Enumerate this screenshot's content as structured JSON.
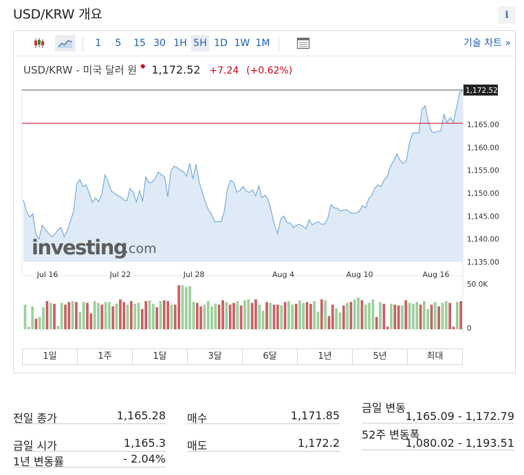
{
  "page": {
    "title": "USD/KRW 개요",
    "info_icon": "i"
  },
  "toolbar": {
    "candle_icon": "candlestick-icon",
    "area_icon": "area-chart-icon",
    "intervals": [
      "1",
      "5",
      "15",
      "30",
      "1H",
      "5H",
      "1D",
      "1W",
      "1M"
    ],
    "selected_interval": "5H",
    "table_icon": "table-icon",
    "tech_chart_label": "기술 차트 »"
  },
  "quote": {
    "name": "USD/KRW - 미국 달러 원",
    "price": "1,172.52",
    "change": "+7.24",
    "change_pct": "(+0.62%)",
    "up_color": "#d0021b"
  },
  "watermark": {
    "brand": "investing",
    "suffix": ".com"
  },
  "chart_data": {
    "type": "area",
    "x_tick_labels": [
      "Jul 16",
      "Jul 22",
      "Jul 28",
      "Aug 4",
      "Aug 10",
      "Aug 16"
    ],
    "y_tick_labels": [
      "1,135.00",
      "1,140.00",
      "1,145.00",
      "1,150.00",
      "1,155.00",
      "1,160.00",
      "1,165.00"
    ],
    "ylim": [
      1135,
      1170
    ],
    "last_price_label": "1,172.52",
    "last_price": 1172.52,
    "reference_line": 1165.28,
    "values": [
      1148.5,
      1146,
      1144.8,
      1145.5,
      1141,
      1140,
      1143,
      1142,
      1141.3,
      1140.5,
      1141,
      1142,
      1142.5,
      1140.5,
      1141.8,
      1144,
      1146,
      1152,
      1153,
      1151.5,
      1151.8,
      1150,
      1148,
      1149,
      1148.2,
      1149.8,
      1154,
      1152.5,
      1150.5,
      1150,
      1149.5,
      1149.2,
      1148.5,
      1148.4,
      1151,
      1150.2,
      1148.1,
      1150.5,
      1148.2,
      1153.6,
      1152.3,
      1152.4,
      1153.2,
      1154.6,
      1154,
      1153.6,
      1149.2,
      1154.8,
      1155.9,
      1155.6,
      1155,
      1154.8,
      1153.7,
      1156.5,
      1153.1,
      1156.3,
      1152.5,
      1150.3,
      1148,
      1146.3,
      1145.3,
      1143.7,
      1143.8,
      1143.8,
      1146,
      1151,
      1152.8,
      1152.4,
      1150.2,
      1150.6,
      1151.5,
      1150.4,
      1150.2,
      1150.7,
      1149.4,
      1151.6,
      1149,
      1149.6,
      1148.6,
      1146,
      1143,
      1141.2,
      1144.4,
      1145,
      1143.6,
      1143.5,
      1142.5,
      1143,
      1143.2,
      1142.8,
      1142.2,
      1144.2,
      1143.1,
      1143.5,
      1143.8,
      1143.2,
      1143.3,
      1144.5,
      1147.5,
      1146.8,
      1146.7,
      1146.1,
      1146.3,
      1146.4,
      1145.8,
      1145.6,
      1145.7,
      1146,
      1147.3,
      1146.8,
      1148.8,
      1149.5,
      1151.1,
      1151.8,
      1151.5,
      1153,
      1153.7,
      1156,
      1157.1,
      1158.6,
      1157.2,
      1156.5,
      1157,
      1161,
      1163.1,
      1163.2,
      1163.1,
      1168.3,
      1169.1,
      1165.7,
      1163.5,
      1163.2,
      1163.5,
      1163.6,
      1167.2,
      1165.5,
      1166.5,
      1165.5,
      1168.7,
      1172,
      1172.52
    ],
    "volume_label_max": "50.0K",
    "volume_label_min": "0",
    "volume_max": 50000,
    "volumes": [
      28000,
      3000,
      26000,
      12000,
      14000,
      25000,
      32000,
      30000,
      29000,
      4000,
      30000,
      28000,
      31000,
      32000,
      31000,
      20000,
      31000,
      30000,
      18000,
      32000,
      30000,
      28000,
      31000,
      31000,
      26000,
      29000,
      34000,
      31000,
      28000,
      32000,
      29000,
      30000,
      23000,
      32000,
      33000,
      29000,
      25000,
      32000,
      33000,
      32000,
      28000,
      28000,
      50000,
      50000,
      48000,
      49000,
      31000,
      30000,
      26000,
      28000,
      32000,
      26000,
      29000,
      28000,
      33000,
      31000,
      28000,
      30000,
      32000,
      27000,
      33000,
      34000,
      30000,
      34000,
      28000,
      21000,
      31000,
      30000,
      28000,
      28000,
      27000,
      31000,
      32000,
      28000,
      29000,
      33000,
      30000,
      31000,
      29000,
      32000,
      20000,
      34000,
      33000,
      15000,
      28000,
      24000,
      19000,
      27000,
      30000,
      31000,
      34000,
      36000,
      33000,
      28000,
      30000,
      34000,
      14000,
      31000,
      29000,
      3000,
      29000,
      28000,
      27000,
      27000,
      33000,
      30000,
      29000,
      31000,
      28000,
      32000,
      23000,
      28000,
      31000,
      26000,
      30000,
      32000,
      30000,
      3000,
      31000,
      32000
    ],
    "volume_color_up": "#9ccf9c",
    "volume_color_down": "#c96060",
    "line_color": "#78a9d6",
    "fill_color": "#deebf6"
  },
  "range_buttons": [
    "1일",
    "1주",
    "1달",
    "3달",
    "6달",
    "1년",
    "5년",
    "최대"
  ],
  "stats": {
    "prev_close_label": "전일 종가",
    "prev_close": "1,165.28",
    "open_label": "금일 시가",
    "open": "1,165.3",
    "change_1y_label": "1년 변동률",
    "change_1y": "- 2.04%",
    "bid_label": "매수",
    "bid": "1,171.85",
    "ask_label": "매도",
    "ask": "1,172.2",
    "day_range_label": "금일 변동",
    "day_range": "1,165.09 - 1,172.79",
    "week52_label": "52주 변동폭",
    "week52": "1,080.02 - 1,193.51"
  }
}
